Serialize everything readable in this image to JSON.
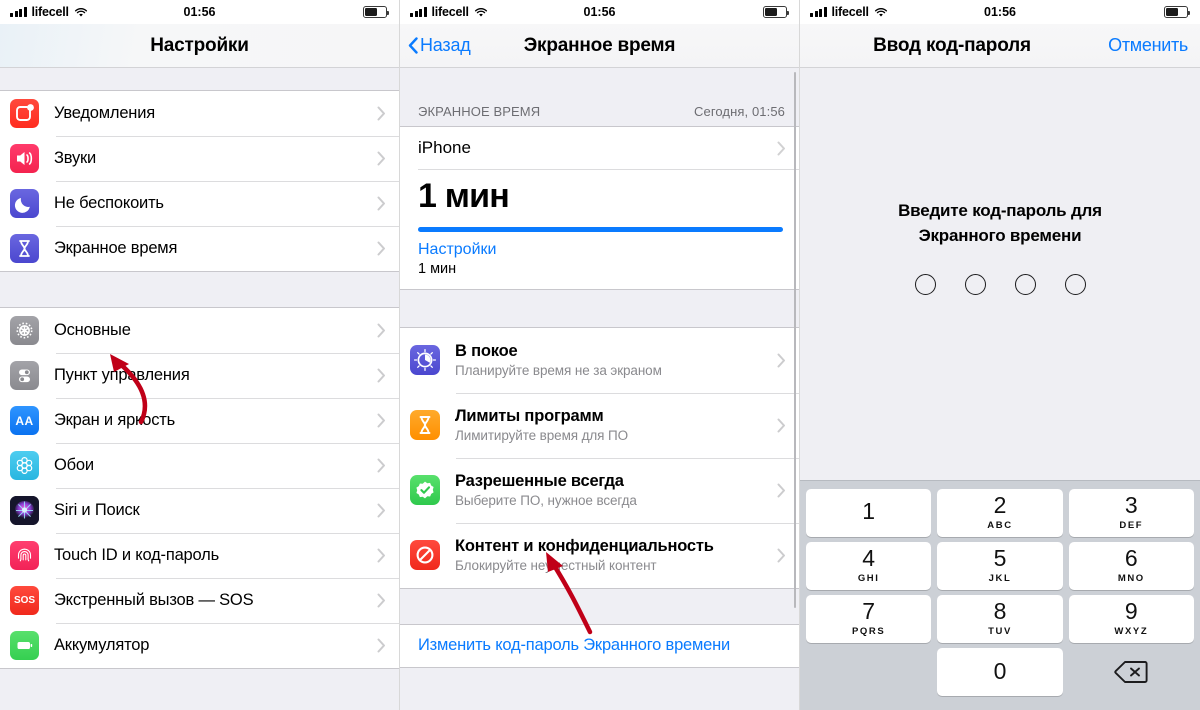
{
  "status_bar": {
    "carrier": "lifecell",
    "time": "01:56",
    "signal_icon": "cellular-bars-icon",
    "wifi_icon": "wifi-icon",
    "battery_icon": "battery-icon"
  },
  "panel1": {
    "title": "Настройки",
    "group1": [
      {
        "label": "Уведомления",
        "icon": "notifications-icon",
        "color": "#ff3b30"
      },
      {
        "label": "Звуки",
        "icon": "sounds-icon",
        "color": "#ff2d55"
      },
      {
        "label": "Не беспокоить",
        "icon": "do-not-disturb-icon",
        "color": "#5856d6"
      },
      {
        "label": "Экранное время",
        "icon": "screen-time-icon",
        "color": "#5856d6"
      }
    ],
    "group2": [
      {
        "label": "Основные",
        "icon": "general-gear-icon",
        "color": "#8e8e93"
      },
      {
        "label": "Пункт управления",
        "icon": "control-center-icon",
        "color": "#8e8e93"
      },
      {
        "label": "Экран и яркость",
        "icon": "display-brightness-icon",
        "color": "#007aff"
      },
      {
        "label": "Обои",
        "icon": "wallpaper-icon",
        "color": "#35c0ed"
      },
      {
        "label": "Siri и Поиск",
        "icon": "siri-icon",
        "color": "#1b1b2f"
      },
      {
        "label": "Touch ID и код-пароль",
        "icon": "touch-id-icon",
        "color": "#ff2d55"
      },
      {
        "label": "Экстренный вызов — SOS",
        "icon": "sos-icon",
        "color": "#ff3b30"
      },
      {
        "label": "Аккумулятор",
        "icon": "battery-settings-icon",
        "color": "#4cd964"
      }
    ]
  },
  "panel2": {
    "back_label": "Назад",
    "title": "Экранное время",
    "section_header": "ЭКРАННОЕ ВРЕМЯ",
    "section_date": "Сегодня, 01:56",
    "device": "iPhone",
    "total_time": "1 мин",
    "progress_percent": 100,
    "category_link": "Настройки",
    "category_time": "1 мин",
    "options": [
      {
        "title": "В покое",
        "subtitle": "Планируйте время не за экраном",
        "icon": "downtime-icon",
        "color": "#5856d6"
      },
      {
        "title": "Лимиты программ",
        "subtitle": "Лимитируйте время для ПО",
        "icon": "app-limits-icon",
        "color": "#ff9500"
      },
      {
        "title": "Разрешенные всегда",
        "subtitle": "Выберите ПО, нужное всегда",
        "icon": "always-allowed-icon",
        "color": "#4cd964"
      },
      {
        "title": "Контент и конфиденциальность",
        "subtitle": "Блокируйте неуместный контент",
        "icon": "content-privacy-icon",
        "color": "#ff3b30"
      }
    ],
    "footer_action": "Изменить код-пароль Экранного времени"
  },
  "panel3": {
    "title": "Ввод код-пароля",
    "cancel_label": "Отменить",
    "prompt_line1": "Введите код-пароль для",
    "prompt_line2": "Экранного времени",
    "dots": 4,
    "keys": [
      {
        "num": "1",
        "letters": ""
      },
      {
        "num": "2",
        "letters": "ABC"
      },
      {
        "num": "3",
        "letters": "DEF"
      },
      {
        "num": "4",
        "letters": "GHI"
      },
      {
        "num": "5",
        "letters": "JKL"
      },
      {
        "num": "6",
        "letters": "MNO"
      },
      {
        "num": "7",
        "letters": "PQRS"
      },
      {
        "num": "8",
        "letters": "TUV"
      },
      {
        "num": "9",
        "letters": "WXYZ"
      },
      {
        "num": "0",
        "letters": ""
      }
    ],
    "delete_icon": "backspace-icon"
  },
  "annotations": {
    "arrow_color": "#c00018",
    "arrow1_target": "Основные",
    "arrow2_target": "Контент и конфиденциальность"
  },
  "colors": {
    "accent": "#0a7bff",
    "list_bg": "#efeff4",
    "separator": "#c8c7cc",
    "keypad_bg": "#ccd0d6"
  }
}
